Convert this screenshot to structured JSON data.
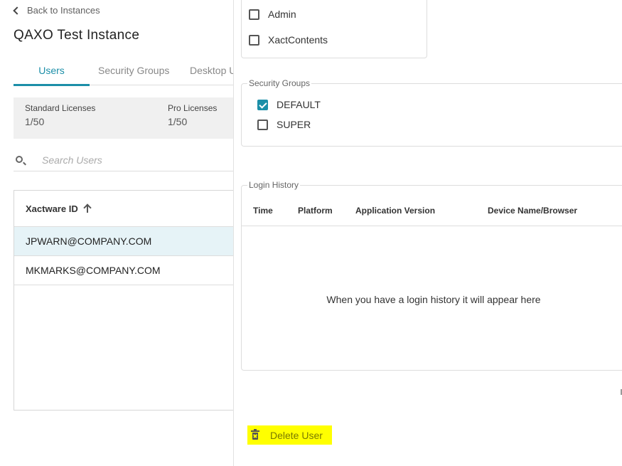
{
  "nav": {
    "back_label": "Back to Instances"
  },
  "page": {
    "title": "QAXO Test Instance"
  },
  "tabs": [
    {
      "label": "Users",
      "active": true
    },
    {
      "label": "Security Groups",
      "active": false
    },
    {
      "label": "Desktop U",
      "active": false
    }
  ],
  "licenses": {
    "standard": {
      "label": "Standard Licenses",
      "value": "1/50"
    },
    "pro": {
      "label": "Pro Licenses",
      "value": "1/50"
    }
  },
  "search": {
    "placeholder": "Search Users",
    "value": ""
  },
  "users_table": {
    "column_header": "Xactware ID",
    "rows": [
      {
        "id": "JPWARN@COMPANY.COM",
        "selected": true
      },
      {
        "id": "MKMARKS@COMPANY.COM",
        "selected": false
      }
    ]
  },
  "roles": [
    {
      "label": "Admin",
      "checked": false
    },
    {
      "label": "XactContents",
      "checked": false
    }
  ],
  "security_groups": {
    "legend": "Security Groups",
    "items": [
      {
        "label": "DEFAULT",
        "checked": true
      },
      {
        "label": "SUPER",
        "checked": false
      }
    ]
  },
  "login_history": {
    "legend": "Login History",
    "columns": [
      "Time",
      "Platform",
      "Application Version",
      "Device Name/Browser"
    ],
    "empty_message": "When you have a login history it will appear here"
  },
  "actions": {
    "delete_label": "Delete User"
  },
  "colors": {
    "accent": "#1c8fa8",
    "highlight": "#ffff00",
    "selected_row": "#e6f3f7"
  }
}
